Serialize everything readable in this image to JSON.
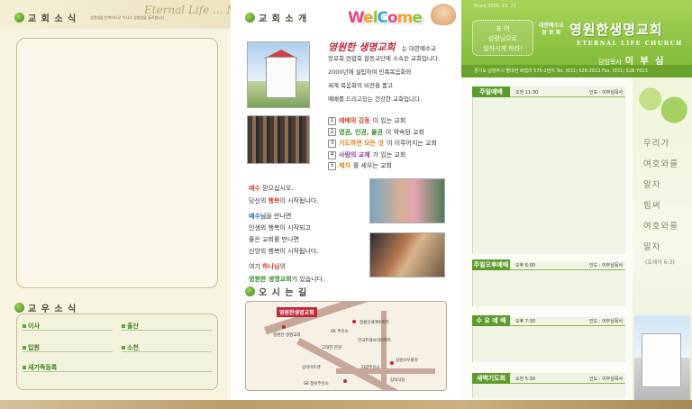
{
  "colors": {
    "brand_green": "#7ab733",
    "accent_red": "#c0283c",
    "gold": "#b99f6a"
  },
  "panel1": {
    "title": "교 회 소 식",
    "small_text": "생명샘을 반복하므로 이사고 생명샘을 돌려봅니다",
    "script_text": "Eternal Life ... News",
    "title2": "교 우 소 식",
    "fields": [
      "이사",
      "출산",
      "입원",
      "소천",
      "새가족등록"
    ]
  },
  "panel2": {
    "title": "교 회 소 개",
    "welcome_letters": [
      "W",
      "e",
      "l",
      "C",
      "o",
      "m",
      "e"
    ],
    "church_name_script": "영원한 생명교회",
    "intro_first": "는 대한예수교",
    "intro_lines": [
      "장로회 연합회 합동교단에 소속된 교회입니다.",
      "2000년에 설립하여 민족복음화와",
      "세계 복음화의 비전을 품고",
      "예배를 드리고있는 건강한 교회입니다."
    ],
    "visions": [
      {
        "num": "1",
        "hl": "예배의 감동",
        "rest": "이 있는 교회"
      },
      {
        "num": "2",
        "hl": "영권, 인권, 물권",
        "rest": "이 약속된 교회"
      },
      {
        "num": "3",
        "hl": "기도하면 모든 것",
        "rest": "이 이루어지는 교회"
      },
      {
        "num": "4",
        "hl": "사랑의 교제",
        "rest": "가 있는 교회"
      },
      {
        "num": "5",
        "hl": "제자",
        "rest": "를 세우는 교회"
      }
    ],
    "message": {
      "l1_hl": "예수",
      "l1_rest": " 믿으십시오.",
      "l2_pre": "당신의 ",
      "l2_hl": "행복",
      "l2_rest": "이 시작됩니다.",
      "l3_hl": "예수님",
      "l3_rest": "을 만나면",
      "l4": "인생의 행복이 시작되고",
      "l5": "좋은 교회를 만나면",
      "l6": "신앙의 행복이 시작됩니다.",
      "l7_pre": "여기 ",
      "l7_hl": "하나님",
      "l7_rest": "의",
      "l8_hl": "영원한 생명교회",
      "l8_rest": "가 있습니다."
    },
    "title3": "오 시 는 길",
    "map": {
      "church": "영원한생명교회",
      "labels": [
        "정릉신세계아파트",
        "한국트랙사대아파트",
        "SK 주유소",
        "고대진 문원",
        "삼원사우플라",
        "삼익아트렌",
        "차량주유소",
        "SK 정비주유소",
        "삼익식당",
        "영원한 생명교회"
      ]
    }
  },
  "panel3": {
    "since": "Since 2000. 10. 21",
    "slogan": [
      "표 어",
      "성령님으로",
      "일하시게 하라!"
    ],
    "denom": [
      "대한예수교",
      "장 로 회"
    ],
    "church_title": "영원한생명교회",
    "church_en": "ETERNAL LIFE CHURCH",
    "pastor_label": "담임목사",
    "pastor_name": "이 부 심",
    "address": "경기도 남양주시 별내면 화접리 575-2번지  Tel. (031) 528-2613   Fax. (031) 528-7613",
    "services": [
      {
        "name": "주일예배",
        "time": "오전 11:30",
        "leader": "인도 : 이부심목사"
      },
      {
        "name": "주일오후예배",
        "time": "오후 6:00",
        "leader": "인도 : 이부심목사"
      },
      {
        "name": "수 요 예 배",
        "time": "오후 7:30",
        "leader": "인도 : 이부심목사"
      },
      {
        "name": "새벽기도회",
        "time": "오전 5:30",
        "leader": "인도 : 이부심목사"
      }
    ],
    "verse_lines": [
      "우리가",
      "여호와를",
      "알자",
      "힘써",
      "여호와를",
      "알자"
    ],
    "verse_ref": "(호세아 6:3)"
  }
}
